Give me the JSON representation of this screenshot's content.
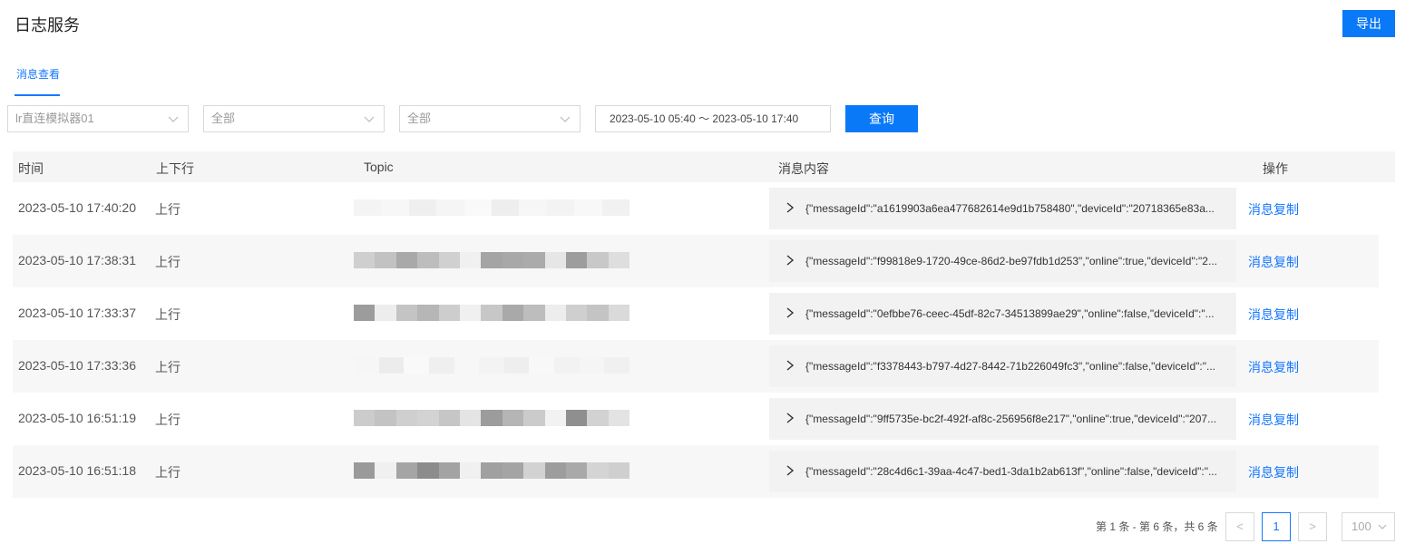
{
  "header": {
    "title": "日志服务",
    "export_label": "导出"
  },
  "tabs": [
    {
      "label": "消息查看",
      "active": true
    }
  ],
  "filters": {
    "device": "lr直连模拟器01",
    "direction": "全部",
    "type": "全部",
    "date_range": "2023-05-10 05:40 ～ 2023-05-10 17:40",
    "query_label": "查询"
  },
  "table": {
    "headers": {
      "time": "时间",
      "direction": "上下行",
      "topic": "Topic",
      "content": "消息内容",
      "action": "操作"
    },
    "rows": [
      {
        "time": "2023-05-10 17:40:20",
        "direction": "上行",
        "content": "{\"messageId\":\"a1619903a6ea477682614e9d1b758480\",\"deviceId\":\"20718365e83a...",
        "action": "消息复制"
      },
      {
        "time": "2023-05-10 17:38:31",
        "direction": "上行",
        "content": "{\"messageId\":\"f99818e9-1720-49ce-86d2-be97fdb1d253\",\"online\":true,\"deviceId\":\"2...",
        "action": "消息复制"
      },
      {
        "time": "2023-05-10 17:33:37",
        "direction": "上行",
        "content": "{\"messageId\":\"0efbbe76-ceec-45df-82c7-34513899ae29\",\"online\":false,\"deviceId\":\"...",
        "action": "消息复制"
      },
      {
        "time": "2023-05-10 17:33:36",
        "direction": "上行",
        "content": "{\"messageId\":\"f3378443-b797-4d27-8442-71b226049fc3\",\"online\":false,\"deviceId\":\"...",
        "action": "消息复制"
      },
      {
        "time": "2023-05-10 16:51:19",
        "direction": "上行",
        "content": "{\"messageId\":\"9ff5735e-bc2f-492f-af8c-256956f8e217\",\"online\":true,\"deviceId\":\"207...",
        "action": "消息复制"
      },
      {
        "time": "2023-05-10 16:51:18",
        "direction": "上行",
        "content": "{\"messageId\":\"28c4d6c1-39aa-4c47-bed1-3da1b2ab613f\",\"online\":false,\"deviceId\":\"...",
        "action": "消息复制"
      }
    ]
  },
  "pagination": {
    "summary": "第 1 条 - 第 6 条，共 6 条",
    "prev": "<",
    "current": "1",
    "next": ">",
    "page_size": "100"
  },
  "colors": {
    "accent": "#0a79f8",
    "link": "#1677ff"
  },
  "icons": {
    "dropdown": "chevron-down-icon",
    "expand": "chevron-right-icon"
  }
}
